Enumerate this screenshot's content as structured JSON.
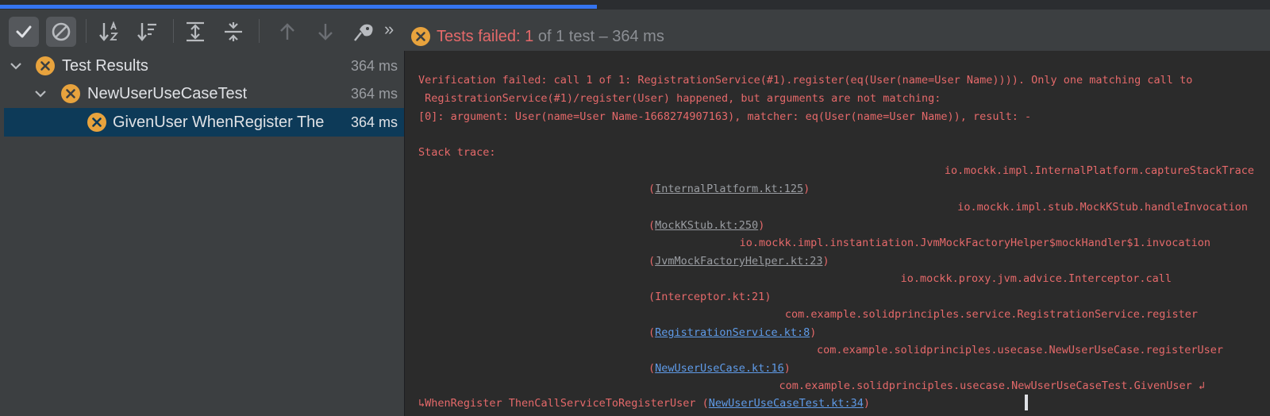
{
  "progress": {
    "fraction": 0.47
  },
  "toolbar": {
    "status_failed": "Tests failed: 1",
    "status_rest": " of 1 test – 364 ms",
    "more_glyph": "»"
  },
  "tree": {
    "items": [
      {
        "label": "Test Results",
        "time": "364 ms"
      },
      {
        "label": "NewUserUseCaseTest",
        "time": "364 ms"
      },
      {
        "label": "GivenUser WhenRegister The",
        "time": "364 ms"
      }
    ]
  },
  "console": {
    "msg1": "Verification failed: call 1 of 1: RegistrationService(#1).register(eq(User(name=User Name)))). Only one matching call to",
    "msg2": " RegistrationService(#1)/register(User) happened, but arguments are not matching:",
    "msg3": "[0]: argument: User(name=User Name-1668274907163), matcher: eq(User(name=User Name)), result: -",
    "stack_label": "Stack trace:",
    "frames": [
      {
        "method": "io.mockk.impl.InternalPlatform.captureStackTrace",
        "file": "InternalPlatform.kt:125"
      },
      {
        "method": "io.mockk.impl.stub.MockKStub.handleInvocation",
        "file": "MockKStub.kt:250"
      },
      {
        "method": "io.mockk.impl.instantiation.JvmMockFactoryHelper$mockHandler$1.invocation",
        "file": "JvmMockFactoryHelper.kt:23"
      },
      {
        "method": "io.mockk.proxy.jvm.advice.Interceptor.call",
        "file": "Interceptor.kt:21"
      },
      {
        "method": "com.example.solidprinciples.service.RegistrationService.register",
        "file": "RegistrationService.kt:8"
      },
      {
        "method": "com.example.solidprinciples.usecase.NewUserUseCase.registerUser",
        "file": "NewUserUseCase.kt:16"
      },
      {
        "method": "com.example.solidprinciples.usecase.NewUserUseCaseTest.GivenUser",
        "file": "NewUserUseCaseTest.kt:34",
        "continuation": "WhenRegister ThenCallServiceToRegisterUser"
      }
    ],
    "wrap_glyph": "↲",
    "wrap_start_glyph": "↳"
  },
  "colors": {
    "error": "#e5696a",
    "link": "#5f9be8",
    "fail_badge": "#e8a33d",
    "selection": "#0d3a58",
    "accent": "#3574f0"
  },
  "icons": [
    "check-icon",
    "cancel-icon",
    "sort-alpha-icon",
    "sort-duration-icon",
    "expand-all-icon",
    "collapse-all-icon",
    "arrow-up-icon",
    "arrow-down-icon",
    "import-tests-icon",
    "chevron-double-right-icon",
    "fail-icon",
    "chevron-down-icon"
  ]
}
